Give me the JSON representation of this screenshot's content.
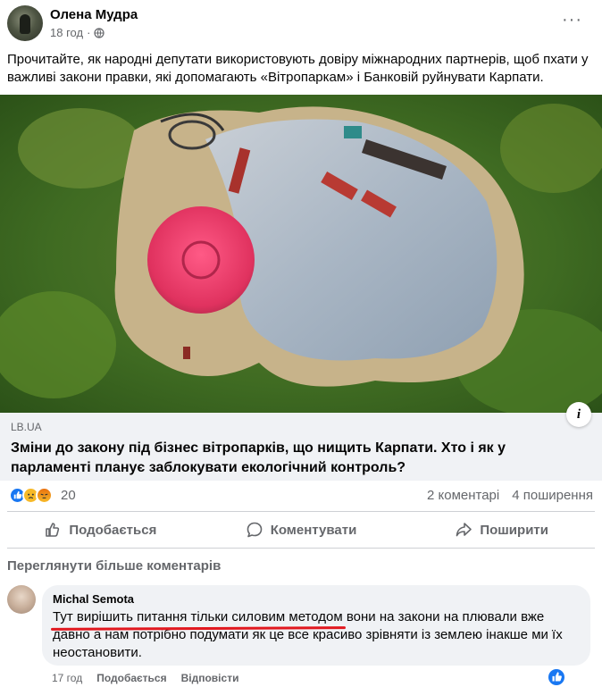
{
  "post": {
    "author": "Олена Мудра",
    "time": "18 год",
    "dot": "·",
    "text": "Прочитайте, як народні депутати використовують довіру міжнародних партнерів, щоб пхати у важливі закони правки, які допомагають «Вітропаркам» і Банковій руйнувати Карпати."
  },
  "link": {
    "domain": "LB.UA",
    "title": "Зміни до закону під бізнес вітропарків, що нищить Карпати. Хто і як у парламенті планує заблокувати екологічний контроль?",
    "info": "i"
  },
  "stats": {
    "reaction_count": "20",
    "comments": "2 коментарі",
    "shares": "4 поширення"
  },
  "actions": {
    "like": "Подобається",
    "comment": "Коментувати",
    "share": "Поширити"
  },
  "comments": {
    "view_more": "Переглянути більше коментарів",
    "items": [
      {
        "author": "Michal Semota",
        "text": "Тут вирішить питання тільки силовим методом вони на закони на плювали вже давно а нам потрібно подумати як це все красиво зрівняти із землею інакше ми їх неостановити.",
        "time": "17 год",
        "like": "Подобається",
        "reply": "Відповісти"
      }
    ]
  },
  "colors": {
    "accent": "#1877f2",
    "secondary_text": "#65676b",
    "link_box_bg": "#f0f2f5",
    "underline": "#e1181f"
  },
  "icons": [
    "globe-icon",
    "more-icon",
    "like-icon",
    "comment-icon",
    "share-icon",
    "info-icon"
  ]
}
